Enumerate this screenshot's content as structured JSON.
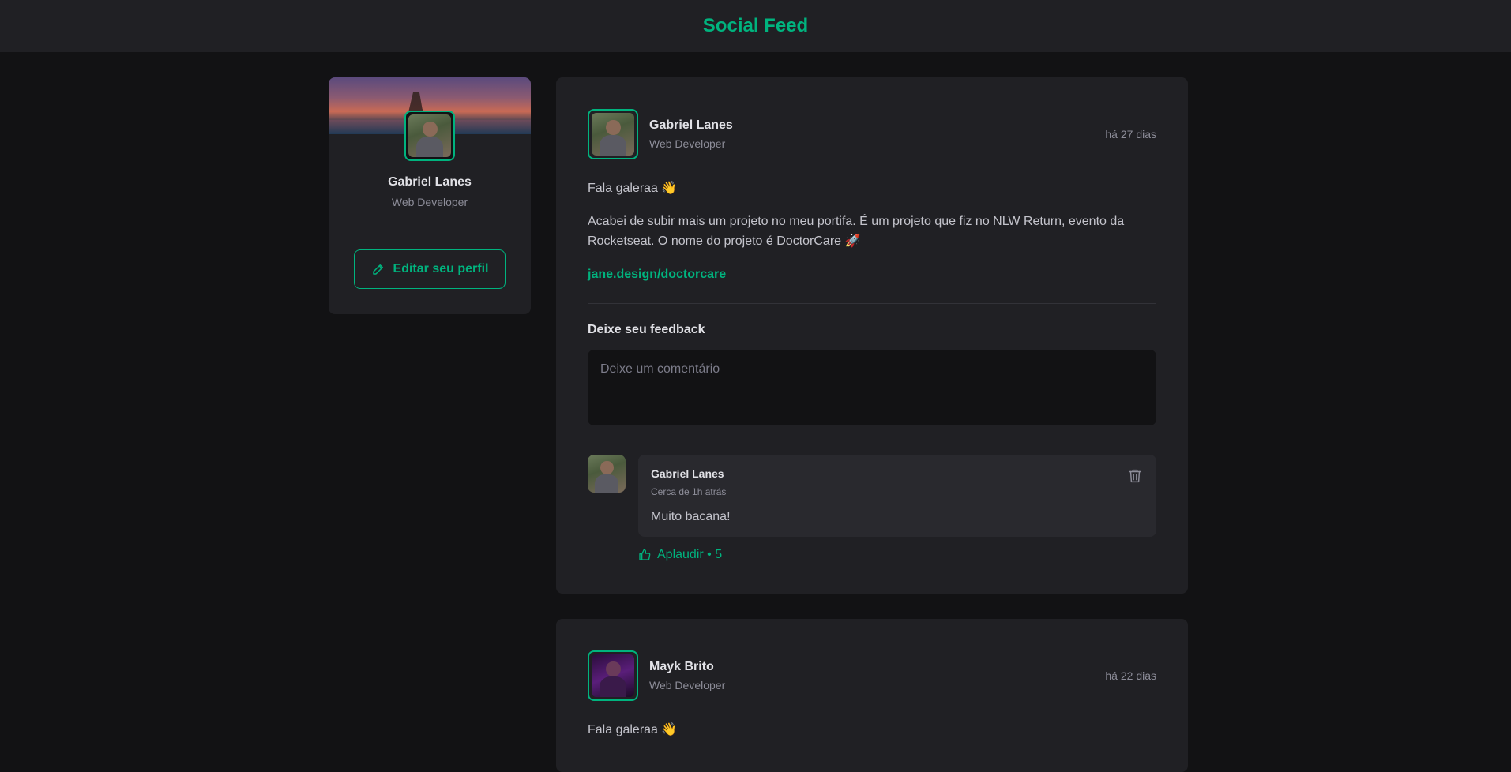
{
  "header": {
    "title": "Social Feed"
  },
  "sidebar": {
    "profile_name": "Gabriel Lanes",
    "profile_role": "Web Developer",
    "edit_button_label": "Editar seu perfil",
    "edit_icon": "pencil-icon"
  },
  "posts": [
    {
      "author": "Gabriel Lanes",
      "role": "Web Developer",
      "time": "há 27 dias",
      "greeting": "Fala galeraa 👋",
      "body": "Acabei de subir mais um projeto no meu portifa. É um projeto que fiz no NLW Return, evento da Rocketseat. O nome do projeto é DoctorCare 🚀",
      "link": "jane.design/doctorcare",
      "feedback_title": "Deixe seu feedback",
      "comment_placeholder": "Deixe um comentário",
      "comments": [
        {
          "author": "Gabriel Lanes",
          "time": "Cerca de 1h atrás",
          "text": "Muito bacana!",
          "applaud_label": "Aplaudir • 5"
        }
      ]
    },
    {
      "author": "Mayk Brito",
      "role": "Web Developer",
      "time": "há 22 dias",
      "greeting": "Fala galeraa 👋"
    }
  ],
  "colors": {
    "accent": "#00b37e",
    "background": "#121214",
    "surface": "#202024"
  }
}
